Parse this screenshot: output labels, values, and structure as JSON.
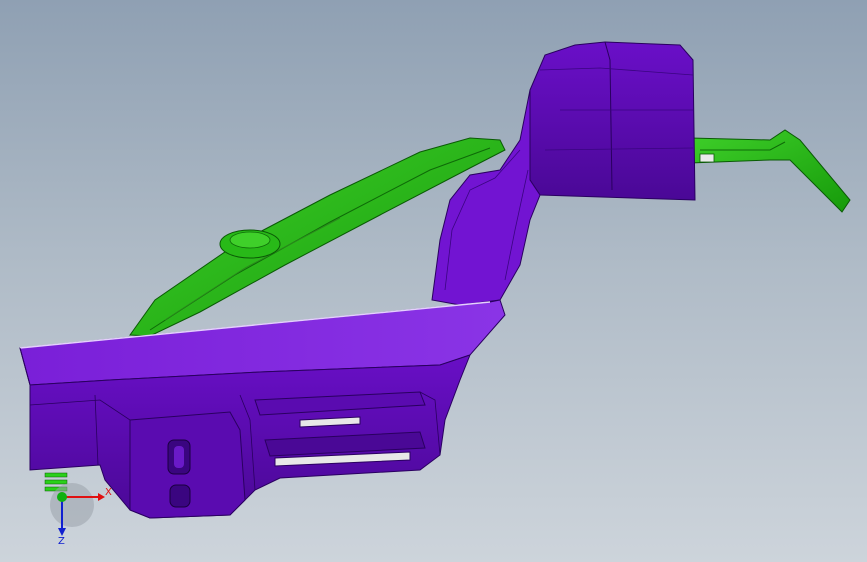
{
  "viewport": {
    "background_top": "#8fa0b3",
    "background_bottom": "#cdd4db"
  },
  "model": {
    "parts": [
      {
        "name": "purple-part",
        "color": "#6a0fc8"
      },
      {
        "name": "green-part",
        "color": "#1fb80f"
      }
    ]
  },
  "triad": {
    "x_label": "X",
    "y_label": "Y",
    "z_label": "Z",
    "x_color": "#e01010",
    "y_color": "#10b010",
    "z_color": "#1020d0"
  }
}
